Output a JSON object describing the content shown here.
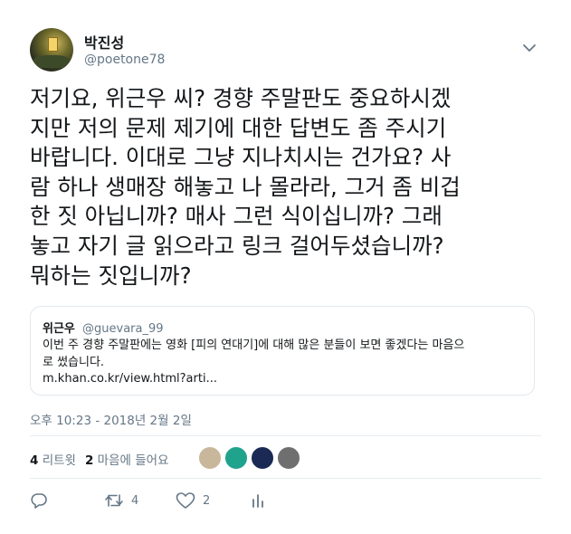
{
  "author": {
    "name": "박진성",
    "handle": "@poetone78"
  },
  "tweet": {
    "text": "저기요, 위근우 씨? 경향 주말판도 중요하시겠\n지만 저의 문제 제기에 대한 답변도 좀 주시기\n바랍니다. 이대로 그냥 지나치시는 건가요? 사\n람 하나 생매장 해놓고 나 몰라라, 그거 좀 비겁\n한 짓 아닙니까? 매사 그런 식이십니까? 그래\n놓고 자기 글 읽으라고 링크 걸어두셨습니까?\n뭐하는 짓입니까?"
  },
  "quoted": {
    "name": "위근우",
    "handle": "@guevara_99",
    "text": "이번 주 경향 주말판에는 영화 [피의 연대기]에 대해 많은 분들이 보면 좋겠다는 마음으\n로 썼습니다.\nm.khan.co.kr/view.html?arti..."
  },
  "timestamp": "오후 10:23 - 2018년 2월 2일",
  "stats": {
    "retweet_count": "4",
    "retweet_label": "리트윗",
    "like_count": "2",
    "like_label": "마음에 들어요"
  },
  "likers": [
    {
      "name": "liker-1",
      "color": "#c8b79a"
    },
    {
      "name": "liker-2",
      "color": "#1fa38c"
    },
    {
      "name": "liker-3",
      "color": "#1b2a55"
    },
    {
      "name": "liker-4",
      "color": "#6f6f6f"
    }
  ],
  "actions": {
    "reply_icon": "reply-icon",
    "retweet_icon": "retweet-icon",
    "retweet_count": "4",
    "like_icon": "heart-icon",
    "like_count": "2",
    "analytics_icon": "analytics-icon"
  },
  "colors": {
    "text": "#14171a",
    "secondary": "#657786",
    "border": "#e1e8ed"
  }
}
